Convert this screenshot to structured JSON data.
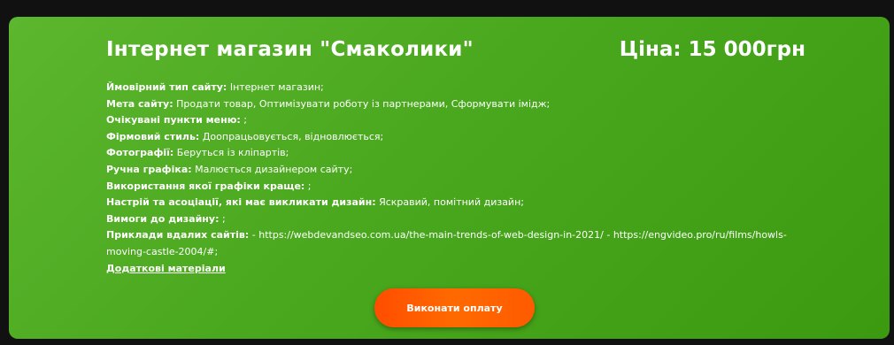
{
  "card": {
    "title": "Інтернет магазин \"Смаколики\"",
    "price": "Ціна: 15 000грн",
    "details": [
      {
        "label": "Ймовірний тип сайту:",
        "value": " Інтернет магазин;"
      },
      {
        "label": "Мета сайту:",
        "value": " Продати товар, Оптимізувати роботу із партнерами, Сформувати імідж;"
      },
      {
        "label": "Очікувані пункти меню:",
        "value": " ;"
      },
      {
        "label": "Фірмовий стиль:",
        "value": " Доопрацьовується, відновлюється;"
      },
      {
        "label": "Фотографії:",
        "value": " Беруться із кліпартів;"
      },
      {
        "label": "Ручна графіка:",
        "value": " Малюється дизайнером сайту;"
      },
      {
        "label": "Використання якої графіки краще:",
        "value": " ;"
      },
      {
        "label": "Настрій та асоціації, які має викликати дизайн:",
        "value": " Яскравий, помітний дизайн;"
      },
      {
        "label": "Вимоги до дизайну:",
        "value": " ;"
      },
      {
        "label": "Приклади вдалих сайтів:",
        "value": " - https://webdevandseo.com.ua/the-main-trends-of-web-design-in-2021/ - https://engvideo.pro/ru/films/howls-moving-castle-2004/#;"
      }
    ],
    "materials_link": "Додаткові матеріали",
    "pay_button": "Виконати оплату"
  },
  "colors": {
    "background": "#111111",
    "card_green": "#4aa81e",
    "button_orange": "#ff5a00",
    "text": "#ffffff"
  }
}
